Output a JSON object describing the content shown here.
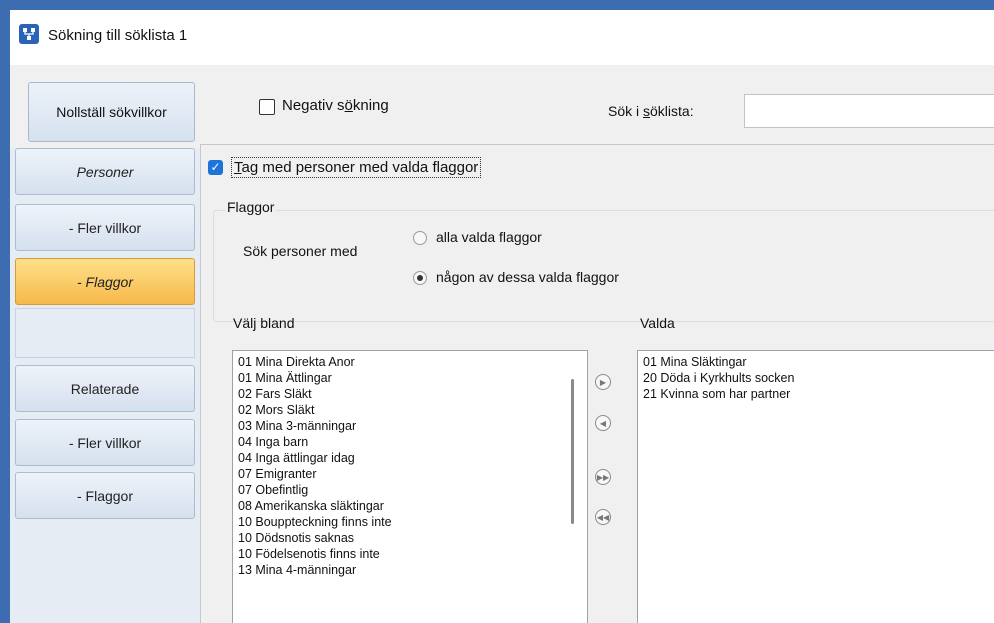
{
  "window": {
    "title": "Sökning till söklista 1"
  },
  "toolbar": {
    "reset_label": "Nollställ sökvillkor",
    "negative_label": "Negativ sökning",
    "negative_checked": false,
    "search_label": "Sök i söklista:",
    "search_value": ""
  },
  "nav": {
    "persons": "Personer",
    "persons_more": "- Fler villkor",
    "persons_flags": "- Flaggor",
    "related": "Relaterade",
    "related_more": "- Fler villkor",
    "related_flags": "- Flaggor"
  },
  "flags": {
    "include_label": "Tag med personer med valda flaggor",
    "include_checked": true,
    "group_title": "Flaggor",
    "search_persons_label": "Sök personer med",
    "option_all": "alla valda flaggor",
    "option_any": "någon av dessa valda flaggor",
    "selected_option": "any",
    "choose_title": "Välj bland",
    "selected_title": "Valda",
    "available": [
      "01 Mina Direkta Anor",
      "01 Mina Ättlingar",
      "02 Fars Släkt",
      "02 Mors Släkt",
      "03 Mina 3-männingar",
      "04 Inga barn",
      "04 Inga ättlingar idag",
      "07 Emigranter",
      "07 Obefintlig",
      "08 Amerikanska släktingar",
      "10 Bouppteckning finns inte",
      "10 Dödsnotis saknas",
      "10 Födelsenotis finns inte",
      "13 Mina 4-männingar"
    ],
    "selected": [
      "01 Mina Släktingar",
      "20 Döda i Kyrkhults socken",
      "21 Kvinna som har partner"
    ]
  },
  "colors": {
    "accent": "#1e73d8",
    "active_nav": "#f6b94a",
    "frame": "#3d6db0"
  }
}
